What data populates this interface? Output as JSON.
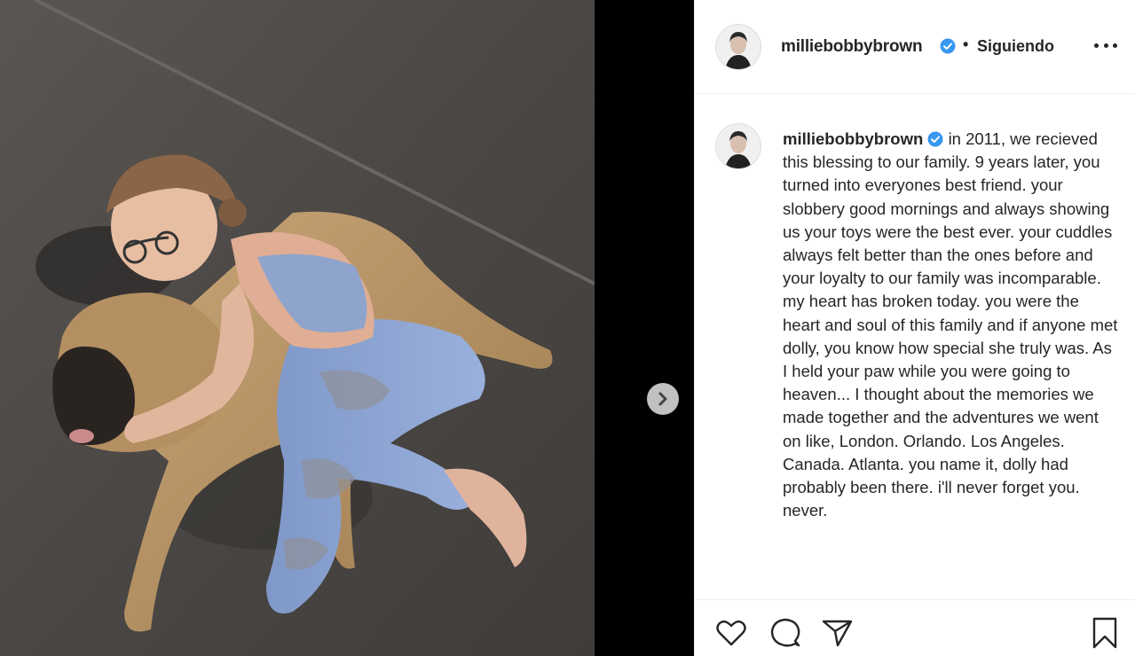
{
  "post": {
    "username": "milliebobbybrown",
    "separator": "•",
    "follow_status": "Siguiendo",
    "caption_text": "in 2011, we recieved this blessing to our family. 9 years later, you turned into everyones best friend. your slobbery good mornings and always showing us your toys were the best ever. your cuddles always felt better than the ones before and your loyalty to our family was incomparable. my heart has broken today. you were the heart and soul of this family and if anyone met dolly, you know how special she truly was. As I held your paw while you were going to heaven... I thought about the memories we made together and the adventures we went on like, London. Orlando. Los Angeles. Canada. Atlanta. you name it, dolly had probably been there. i'll never forget you. never."
  },
  "icons": {
    "verified": "verified-badge-icon",
    "more": "more-options-icon",
    "next": "chevron-right-icon",
    "like": "heart-icon",
    "comment": "comment-bubble-icon",
    "share": "paper-plane-icon",
    "save": "bookmark-icon"
  },
  "colors": {
    "verified": "#3897f0",
    "text": "#262626",
    "divider": "#efefef",
    "media_background": "#000000"
  }
}
